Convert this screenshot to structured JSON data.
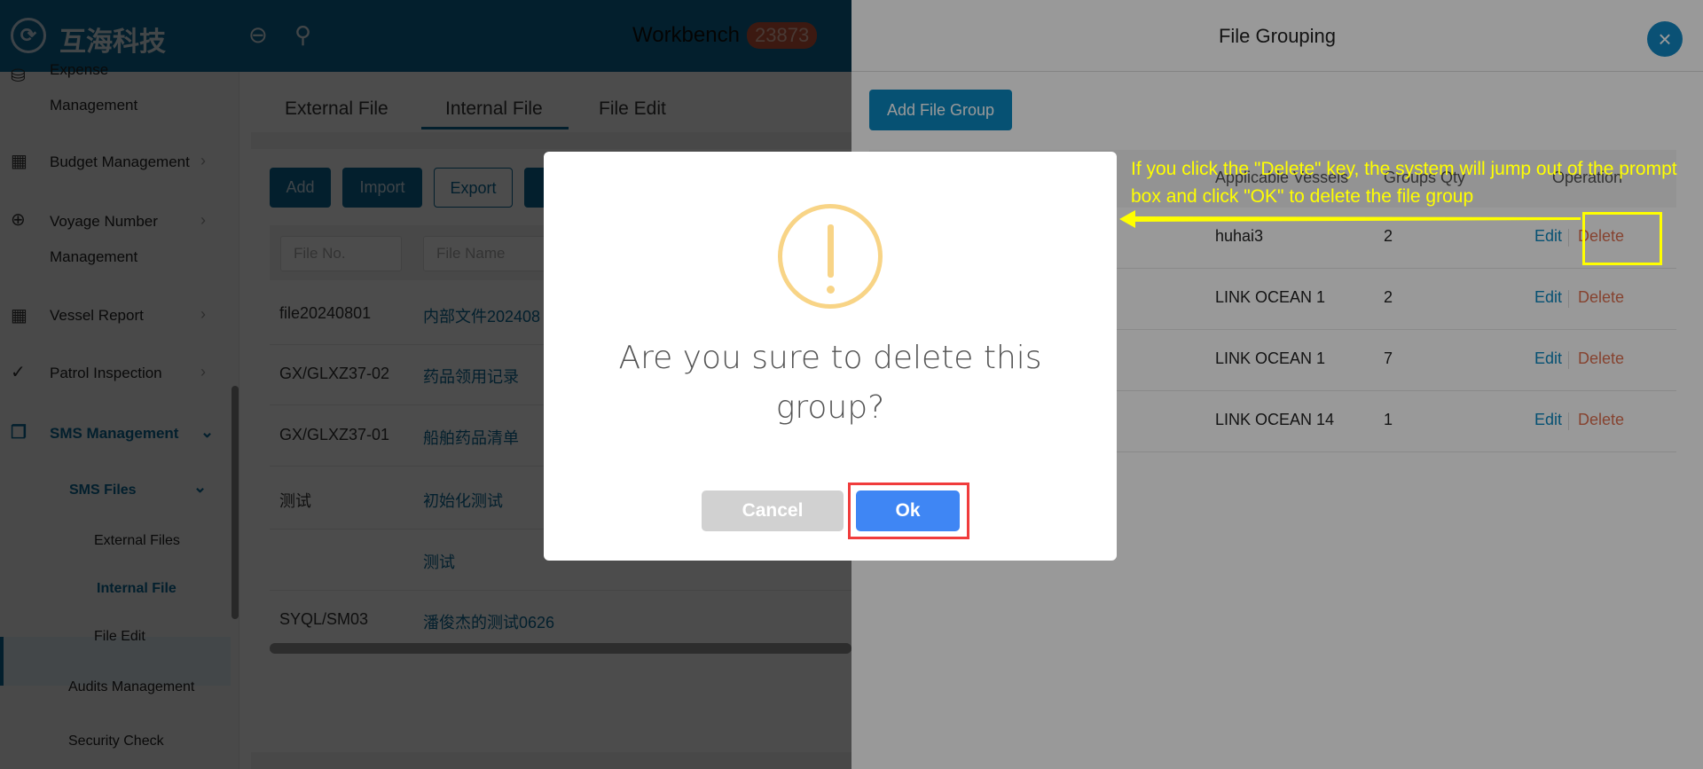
{
  "header": {
    "brand": "互海科技",
    "workbench": "Workbench",
    "badge": "23873"
  },
  "sidebar": {
    "items": [
      {
        "label": "Expense",
        "label2": "Management",
        "icon": "coins-icon"
      },
      {
        "label": "Budget Management",
        "icon": "calculator-icon"
      },
      {
        "label": "Voyage Number",
        "label2": "Management",
        "icon": "globe-icon"
      },
      {
        "label": "Vessel Report",
        "icon": "calendar-icon"
      },
      {
        "label": "Patrol Inspection",
        "icon": "check-circle-icon"
      },
      {
        "label": "SMS Management",
        "icon": "document-icon"
      }
    ],
    "sub": {
      "sms_files": "SMS Files",
      "external": "External Files",
      "internal": "Internal File",
      "edit": "File Edit",
      "audits": "Audits Management",
      "security": "Security Check"
    }
  },
  "main": {
    "tabs": [
      "External File",
      "Internal File",
      "File Edit"
    ],
    "buttons": {
      "add": "Add",
      "import": "Import",
      "export": "Export"
    },
    "filters": {
      "file_no": "File No.",
      "file_name": "File Name"
    },
    "rows": [
      [
        "file20240801",
        "内部文件202408"
      ],
      [
        "GX/GLXZ37-02",
        "药品领用记录"
      ],
      [
        "GX/GLXZ37-01",
        "船舶药品清单"
      ],
      [
        "测试",
        "初始化测试"
      ],
      [
        "",
        "测试"
      ],
      [
        "SYQL/SM03",
        "潘俊杰的测试0626"
      ]
    ]
  },
  "drawer": {
    "title": "File Grouping",
    "add": "Add File Group",
    "columns": [
      "Applicable Vessels",
      "Groups Qty",
      "Operation"
    ],
    "rows": [
      [
        "huhai3",
        "2"
      ],
      [
        "LINK OCEAN 1",
        "2"
      ],
      [
        "LINK OCEAN 1",
        "7"
      ],
      [
        "LINK OCEAN 14",
        "1"
      ]
    ],
    "edit": "Edit",
    "delete": "Delete"
  },
  "dialog": {
    "message": "Are you sure to delete this group?",
    "cancel": "Cancel",
    "ok": "Ok"
  },
  "annotation": {
    "text": "If you click the \"Delete\" key, the system will jump out of the prompt box and click \"OK\" to delete the file group"
  },
  "colors": {
    "primary": "#0a6a96",
    "ok": "#3f86f4",
    "warning": "#f8d486",
    "annotation": "#ffff00",
    "highlight": "#f03c3c"
  }
}
